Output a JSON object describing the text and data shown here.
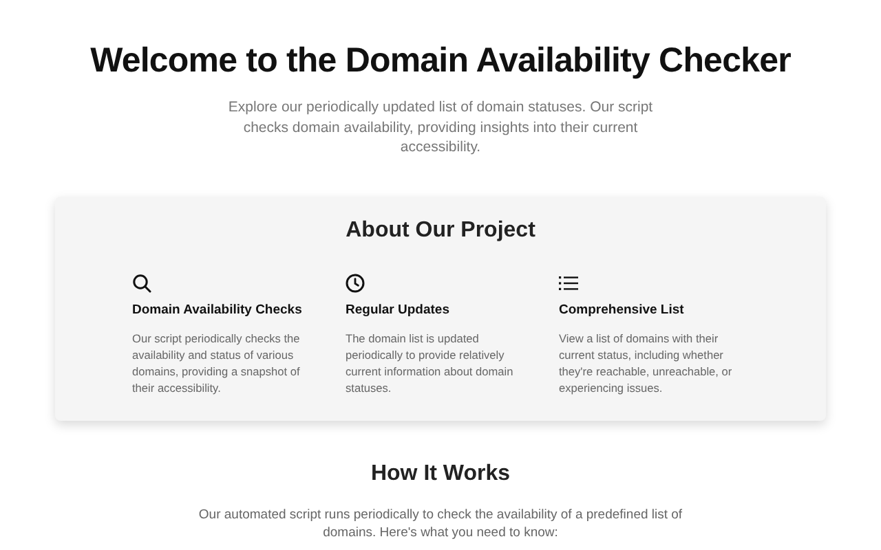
{
  "hero": {
    "title": "Welcome to the Domain Availability Checker",
    "subtitle": "Explore our periodically updated list of domain statuses. Our script checks domain availability, providing insights into their current accessibility."
  },
  "about": {
    "title": "About Our Project",
    "features": [
      {
        "kind": "search",
        "title": "Domain Availability Checks",
        "text": "Our script periodically checks the availability and status of various domains, providing a snapshot of their accessibility."
      },
      {
        "kind": "clock",
        "title": "Regular Updates",
        "text": "The domain list is updated periodically to provide relatively current information about domain statuses."
      },
      {
        "kind": "list",
        "title": "Comprehensive List",
        "text": "View a list of domains with their current status, including whether they're reachable, unreachable, or experiencing issues."
      }
    ]
  },
  "how": {
    "title": "How It Works",
    "text": "Our automated script runs periodically to check the availability of a predefined list of domains. Here's what you need to know:"
  }
}
